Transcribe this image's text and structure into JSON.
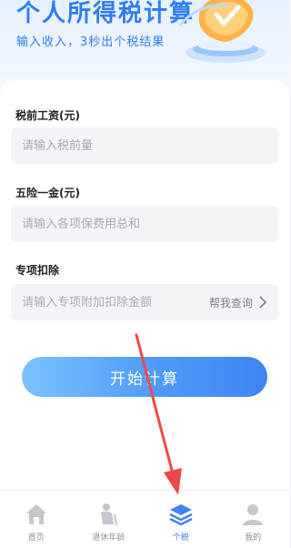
{
  "header": {
    "title": "个人所得税计算",
    "subtitle": "输入收入，3秒出个税结果"
  },
  "form": {
    "salary": {
      "label": "税前工资(元)",
      "placeholder": "请输入税前量"
    },
    "insurance": {
      "label": "五险一金(元)",
      "placeholder": "请输入各项保费用总和"
    },
    "deduction": {
      "label": "专项扣除",
      "placeholder": "请输入专项附加扣除金额",
      "lookup_label": "帮我查询"
    }
  },
  "start_button": {
    "label": "开始计算"
  },
  "tabbar": {
    "items": [
      {
        "label": "首页",
        "icon": "home-icon",
        "active": false
      },
      {
        "label": "退休年龄",
        "icon": "elderly-person-icon",
        "active": false
      },
      {
        "label": "个税",
        "icon": "layers-icon",
        "active": true
      },
      {
        "label": "我的",
        "icon": "user-icon",
        "active": false
      }
    ]
  },
  "colors": {
    "accent": "#2f7df6",
    "button_gradient_start": "#7bc3ff",
    "button_gradient_end": "#3f84f2",
    "annotation_arrow": "#f04848",
    "tab_inactive": "#bfc3ca"
  }
}
